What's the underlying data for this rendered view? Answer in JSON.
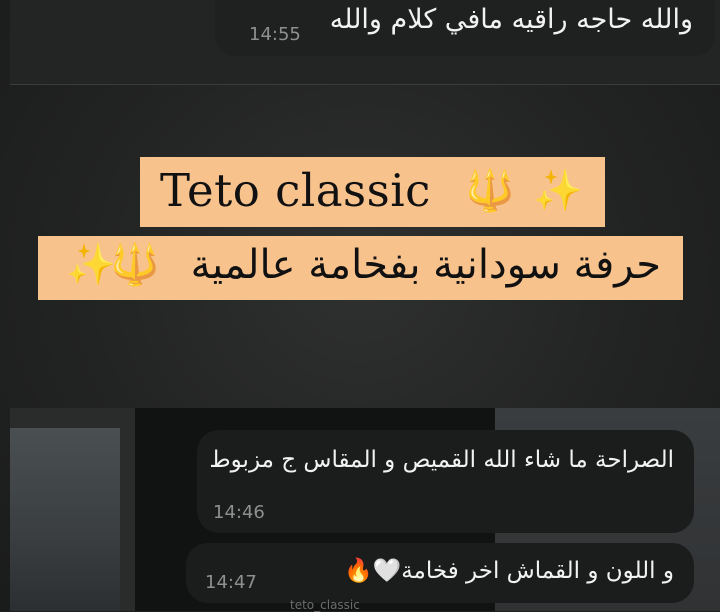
{
  "top_message": {
    "text": "والله حاجه راقيه مافي كلام والله",
    "time": "14:55"
  },
  "banner": {
    "brand": "Teto classic",
    "brand_emoji": [
      "trident-emoji",
      "sparkles-emoji"
    ],
    "tagline": "حرفة سودانية بفخامة عالمية",
    "tagline_emoji": [
      "trident-emoji",
      "sparkles-emoji"
    ],
    "background_color": "#f8c28d"
  },
  "messages": [
    {
      "text": "الصراحة ما شاء الله القميص و المقاس ج مزبوط",
      "time": "14:46"
    },
    {
      "text": "و اللون و القماش اخر فخامة🤍🔥",
      "time": "14:47"
    }
  ],
  "footer_faint": "teto_classic"
}
